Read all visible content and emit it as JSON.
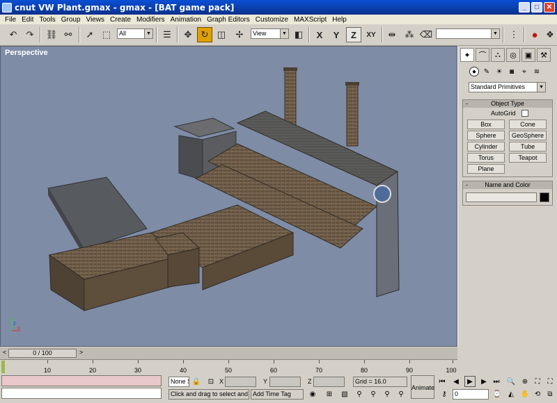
{
  "window": {
    "title": "cnut VW Plant.gmax - gmax - [BAT game pack]",
    "minimize": "_",
    "maximize": "□",
    "close": "✕"
  },
  "menu": [
    "File",
    "Edit",
    "Tools",
    "Group",
    "Views",
    "Create",
    "Modifiers",
    "Animation",
    "Graph Editors",
    "Customize",
    "MAXScript",
    "Help"
  ],
  "toolbar": {
    "selection_filter": "All",
    "ref_coord": "View",
    "axis_x": "X",
    "axis_y": "Y",
    "axis_z": "Z",
    "axis_xy": "XY",
    "named_sel": ""
  },
  "viewport": {
    "label": "Perspective",
    "bg_color": "#7e8ca6"
  },
  "command_panel": {
    "category": "Standard Primitives",
    "object_type": {
      "title": "Object Type",
      "autogrid": "AutoGrid",
      "buttons": [
        "Box",
        "Cone",
        "Sphere",
        "GeoSphere",
        "Cylinder",
        "Tube",
        "Torus",
        "Teapot",
        "Plane"
      ]
    },
    "name_color": {
      "title": "Name and Color",
      "name_value": "",
      "color": "#000000"
    }
  },
  "timeline": {
    "slider": "0 / 100",
    "ticks": [
      "10",
      "20",
      "30",
      "40",
      "50",
      "60",
      "70",
      "80",
      "90",
      "100"
    ]
  },
  "status": {
    "selection": "None S",
    "x_label": "X",
    "y_label": "Y",
    "z_label": "Z",
    "x_val": "",
    "y_val": "",
    "z_val": "",
    "grid": "Grid = 16.0",
    "prompt": "Click and drag to select and ro",
    "add_time_tag": "Add Time Tag",
    "animate": "Animate",
    "frame": "0"
  }
}
